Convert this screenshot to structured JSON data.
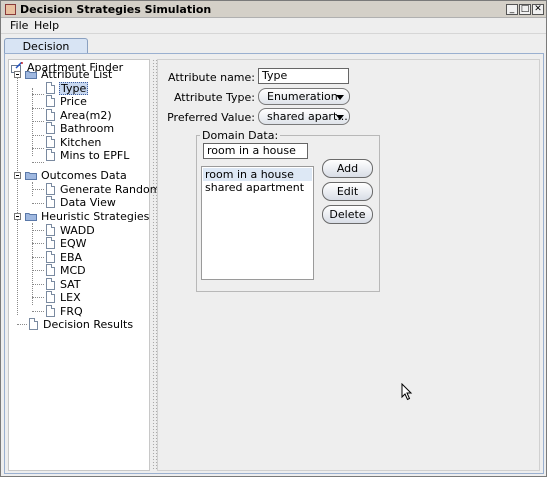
{
  "window": {
    "title": "Decision Strategies Simulation",
    "controls": {
      "minimize": "_",
      "maximize": "□",
      "close": "✕"
    }
  },
  "menu": {
    "items": [
      "File",
      "Help"
    ]
  },
  "tabs": [
    {
      "label": "Decision Problem",
      "selected": true
    }
  ],
  "tree": {
    "root": "Apartment Finder",
    "attribute_list": {
      "label": "Attribute List",
      "items": [
        "Type",
        "Price",
        "Area(m2)",
        "Bathroom",
        "Kitchen",
        "Mins to EPFL"
      ]
    },
    "outcomes_data": {
      "label": "Outcomes Data",
      "items": [
        "Generate Randomly",
        "Data View"
      ]
    },
    "heuristic_strategies": {
      "label": "Heuristic Strategies",
      "items": [
        "WADD",
        "EQW",
        "EBA",
        "MCD",
        "SAT",
        "LEX",
        "FRQ"
      ]
    },
    "decision_results": "Decision Results",
    "selected_item": "Type"
  },
  "form": {
    "attribute_name_label": "Attribute name:",
    "attribute_name_value": "Type",
    "attribute_type_label": "Attribute Type:",
    "attribute_type_value": "Enumeration",
    "preferred_value_label": "Preferred Value:",
    "preferred_value_value": "shared apart...",
    "domain_data": {
      "title": "Domain Data:",
      "input_value": "room in a house",
      "list": [
        "room in a house",
        "shared apartment"
      ],
      "selected_index": 0,
      "buttons": {
        "add": "Add",
        "edit": "Edit",
        "delete": "Delete"
      }
    }
  },
  "colors": {
    "window_bg": "#eeeeee",
    "titlebar_bg": "#d4d0c8",
    "tab_bg": "#d8e4f4",
    "selection_bg": "#c8d8f0",
    "tree_bg": "#ffffff"
  }
}
